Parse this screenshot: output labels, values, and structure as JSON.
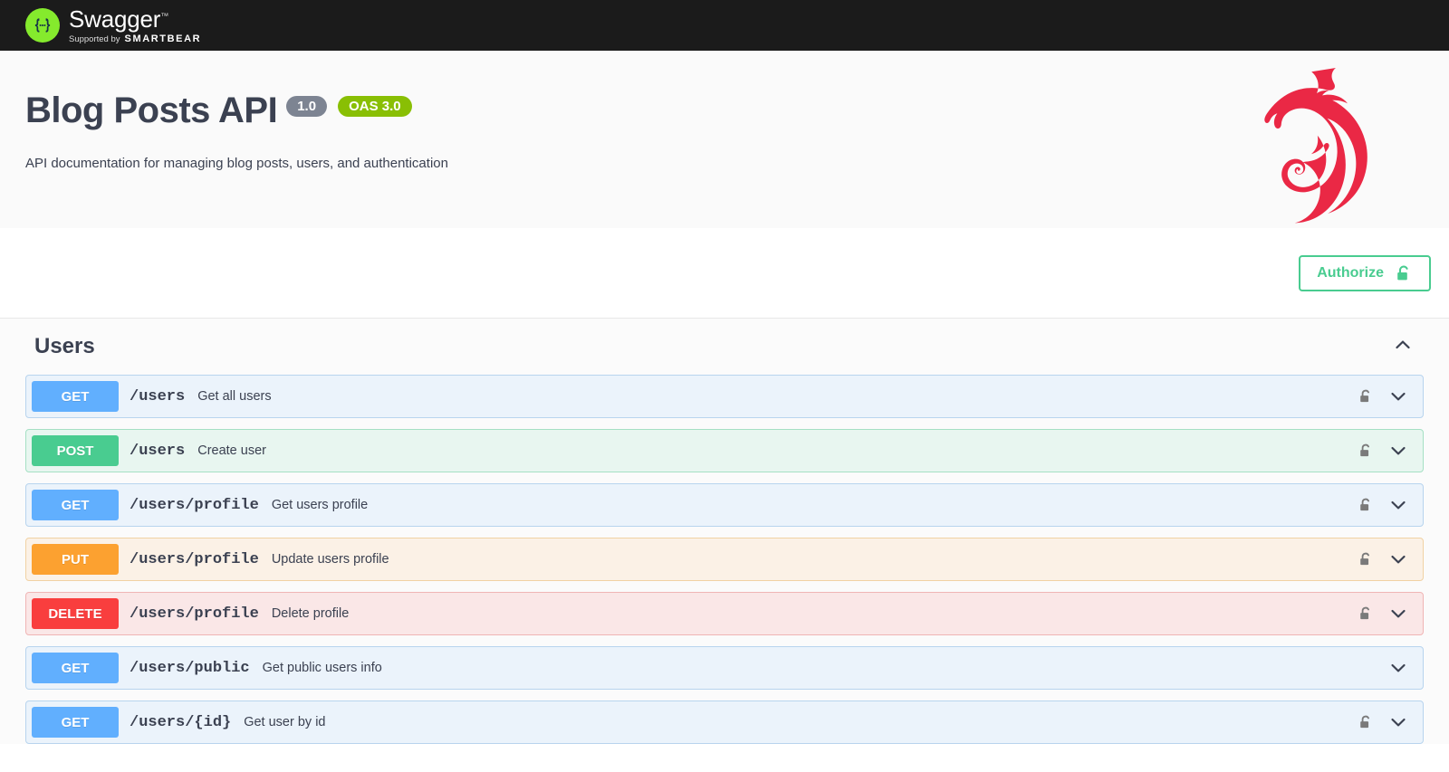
{
  "topbar": {
    "logo_mark_text": "{…}",
    "logo_title": "Swagger",
    "logo_tm": "™",
    "supported_by": "Supported by",
    "brand": "SMARTBEAR"
  },
  "info": {
    "title": "Blog Posts API",
    "version_badge": "1.0",
    "oas_badge": "OAS 3.0",
    "description": "API documentation for managing blog posts, users, and authentication",
    "logo_icon": "nestjs-cat-logo",
    "logo_color": "#ea2845"
  },
  "auth": {
    "authorize_label": "Authorize",
    "lock_icon": "unlocked-padlock-icon",
    "accent_color": "#49cc90"
  },
  "sections": [
    {
      "title": "Users",
      "collapse_icon": "chevron-up-icon",
      "expanded": true,
      "operations": [
        {
          "method": "GET",
          "method_class": "get",
          "path": "/users",
          "summary": "Get all users",
          "secured": true,
          "lock_icon": "unlocked-padlock-icon",
          "expand_icon": "chevron-down-icon",
          "color": "#61affe"
        },
        {
          "method": "POST",
          "method_class": "post",
          "path": "/users",
          "summary": "Create user",
          "secured": true,
          "lock_icon": "unlocked-padlock-icon",
          "expand_icon": "chevron-down-icon",
          "color": "#49cc90"
        },
        {
          "method": "GET",
          "method_class": "get",
          "path": "/users/profile",
          "summary": "Get users profile",
          "secured": true,
          "lock_icon": "unlocked-padlock-icon",
          "expand_icon": "chevron-down-icon",
          "color": "#61affe"
        },
        {
          "method": "PUT",
          "method_class": "put",
          "path": "/users/profile",
          "summary": "Update users profile",
          "secured": true,
          "lock_icon": "unlocked-padlock-icon",
          "expand_icon": "chevron-down-icon",
          "color": "#fca130"
        },
        {
          "method": "DELETE",
          "method_class": "delete",
          "path": "/users/profile",
          "summary": "Delete profile",
          "secured": true,
          "lock_icon": "unlocked-padlock-icon",
          "expand_icon": "chevron-down-icon",
          "color": "#f93e3e"
        },
        {
          "method": "GET",
          "method_class": "get",
          "path": "/users/public",
          "summary": "Get public users info",
          "secured": false,
          "lock_icon": "",
          "expand_icon": "chevron-down-icon",
          "color": "#61affe"
        },
        {
          "method": "GET",
          "method_class": "get",
          "path": "/users/{id}",
          "summary": "Get user by id",
          "secured": true,
          "lock_icon": "unlocked-padlock-icon",
          "expand_icon": "chevron-down-icon",
          "color": "#61affe"
        }
      ]
    }
  ]
}
